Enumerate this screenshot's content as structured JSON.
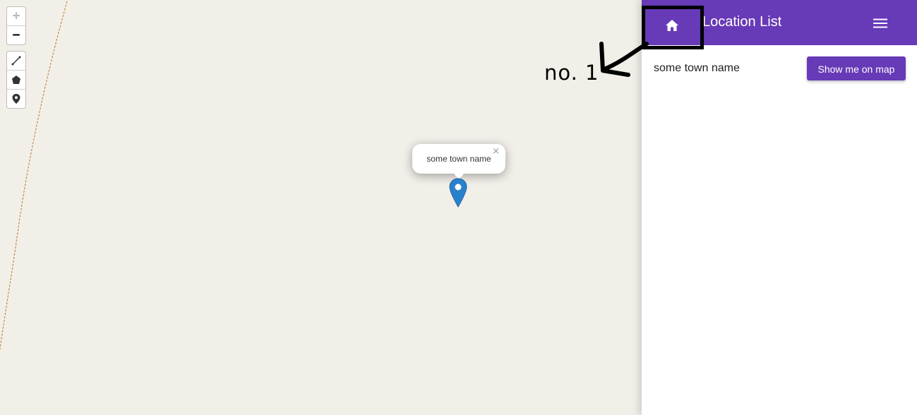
{
  "map": {
    "zoom_in_label": "+",
    "zoom_out_label": "−",
    "draw_tools": [
      {
        "icon": "polyline-icon"
      },
      {
        "icon": "polygon-icon"
      },
      {
        "icon": "marker-icon"
      }
    ],
    "popup": {
      "text": "some town name",
      "close_label": "×"
    }
  },
  "annotation": {
    "label": "no. 1"
  },
  "panel": {
    "title": "Location List",
    "home_icon": "home-icon",
    "menu_icon": "menu-icon",
    "items": [
      {
        "label": "some town name",
        "button_label": "Show me on map"
      }
    ]
  },
  "colors": {
    "accent": "#673ab7",
    "map_background": "#f2efe9",
    "marker": "#2a81cb",
    "boundary": "#c08a3e"
  }
}
